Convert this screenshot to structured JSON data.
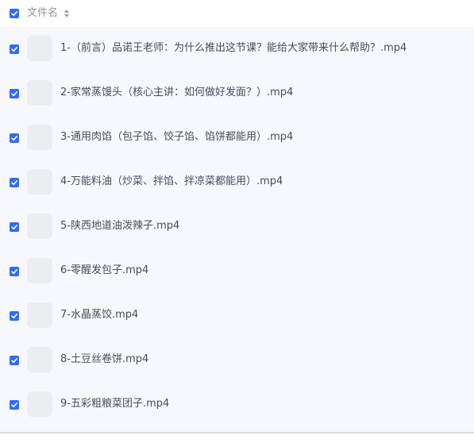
{
  "header": {
    "column_label": "文件名",
    "select_all_checked": true,
    "sort_icon": "sort-icon"
  },
  "files": [
    {
      "name": "1-（前言）品诺王老师：为什么推出这节课？能给大家带来什么帮助？.mp4",
      "checked": true
    },
    {
      "name": "2-家常蒸馒头（核心主讲：如何做好发面？）.mp4",
      "checked": true
    },
    {
      "name": "3-通用肉馅（包子馅、饺子馅、馅饼都能用）.mp4",
      "checked": true
    },
    {
      "name": "4-万能料油（炒菜、拌馅、拌凉菜都能用）.mp4",
      "checked": true
    },
    {
      "name": "5-陕西地道油泼辣子.mp4",
      "checked": true
    },
    {
      "name": "6-零醒发包子.mp4",
      "checked": true
    },
    {
      "name": "7-水晶蒸饺.mp4",
      "checked": true
    },
    {
      "name": "8-土豆丝卷饼.mp4",
      "checked": true
    },
    {
      "name": "9-五彩粗粮菜团子.mp4",
      "checked": true
    }
  ],
  "colors": {
    "checkbox": "#2f6bff",
    "row_background": "#f7f8fd",
    "thumbnail": "#ebedf0",
    "text": "#454d5a",
    "header_text": "#8e939c"
  }
}
